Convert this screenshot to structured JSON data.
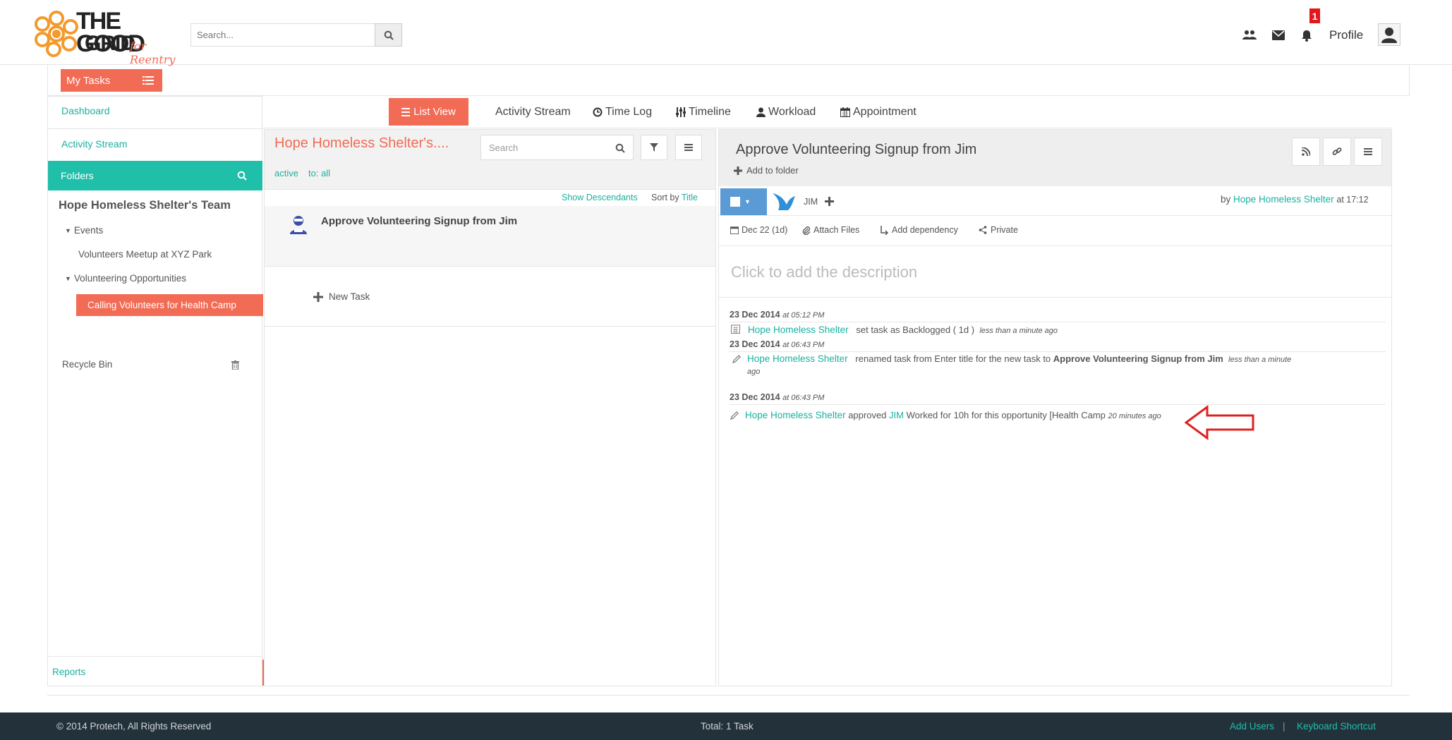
{
  "colors": {
    "accent": "#f26b55",
    "teal": "#1fbfaa",
    "link": "#1ab1a0",
    "footer_bg": "#23313a",
    "annotation": "#e02020"
  },
  "brand": {
    "logo_line1": "THE GOOD",
    "logo_line2": "GRID",
    "logo_tagline": "for Reentry"
  },
  "header": {
    "search_placeholder": "Search...",
    "notification_count": "1",
    "profile_label": "Profile",
    "icons": [
      "users-icon",
      "envelope-icon",
      "bell-icon",
      "avatar-icon"
    ]
  },
  "toolbar": {
    "my_tasks_label": "My Tasks"
  },
  "sidebar": {
    "dashboard": "Dashboard",
    "activity_stream": "Activity Stream",
    "folders": "Folders",
    "team": "Hope Homeless Shelter's Team",
    "tree": [
      {
        "label": "Events"
      },
      {
        "label": "Volunteers Meetup at XYZ Park"
      },
      {
        "label": "Volunteering Opportunities"
      },
      {
        "label": "Calling Volunteers for Health Camp",
        "active": true
      }
    ],
    "recycle_bin": "Recycle Bin",
    "reports": "Reports"
  },
  "tabs": [
    {
      "label": "List View",
      "icon": "list-icon",
      "active": true
    },
    {
      "label": "Activity Stream",
      "icon": ""
    },
    {
      "label": "Time Log",
      "icon": "clock-icon"
    },
    {
      "label": "Timeline",
      "icon": "sliders-icon"
    },
    {
      "label": "Workload",
      "icon": "user-icon"
    },
    {
      "label": "Appointment",
      "icon": "calendar-icon"
    }
  ],
  "list": {
    "title": "Hope Homeless Shelter's....",
    "search_placeholder": "Search",
    "filter_active": "active",
    "filter_to": "to: all",
    "show_descendants": "Show Descendants",
    "sort_by": "Sort by",
    "sort_field": "Title",
    "tasks": [
      {
        "title": "Approve Volunteering Signup from Jim"
      }
    ],
    "new_task": "New Task"
  },
  "detail": {
    "title": "Approve Volunteering Signup from Jim",
    "add_to_folder": "Add to folder",
    "assignee": "JIM",
    "by_label": "by",
    "author": "Hope Homeless Shelter",
    "time": "at 17:12",
    "date_label": "Dec 22 (1d)",
    "attach_files": "Attach Files",
    "add_dependency": "Add dependency",
    "private": "Private",
    "description_placeholder": "Click to add the description",
    "stream": [
      {
        "date": "23 Dec 2014",
        "time": "at 05:12 PM",
        "user": "Hope Homeless Shelter",
        "text": "set task as Backlogged ( 1d )",
        "ago": "less than a minute ago"
      },
      {
        "date": "23 Dec 2014",
        "time": "at 06:43 PM",
        "user": "Hope Homeless Shelter",
        "text": "renamed task from Enter title for the new task to",
        "bold": "Approve Volunteering Signup from Jim",
        "ago1": "less than a minute",
        "ago2": "ago"
      },
      {
        "date": "23 Dec 2014",
        "time": "at 06:43 PM",
        "user": "Hope Homeless Shelter",
        "verb": "approved",
        "target": "JIM",
        "text": "Worked for 10h for this opportunity [Health Camp",
        "ago": "20 minutes ago"
      }
    ]
  },
  "footer": {
    "copyright": "© 2014 Protech, All Rights Reserved",
    "total": "Total: 1 Task",
    "add_users": "Add Users",
    "separator": "|",
    "keyboard_shortcut": "Keyboard Shortcut"
  }
}
